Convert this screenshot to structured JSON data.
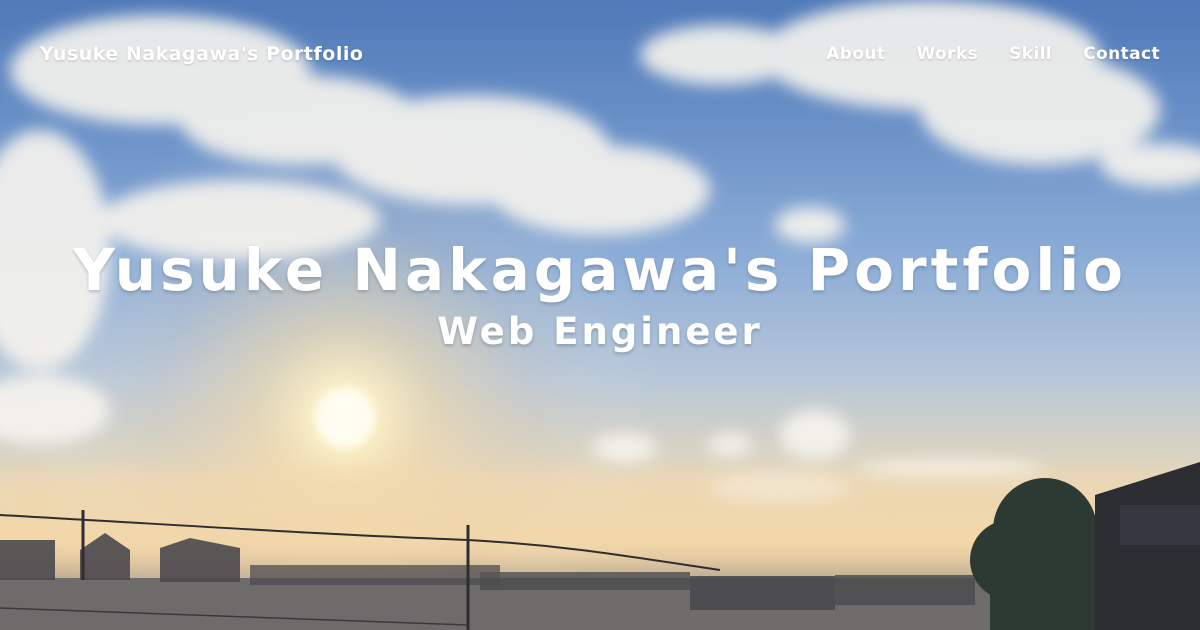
{
  "header": {
    "brand": "Yusuke Nakagawa's Portfolio",
    "nav": [
      {
        "label": "About"
      },
      {
        "label": "Works"
      },
      {
        "label": "Skill"
      },
      {
        "label": "Contact"
      }
    ]
  },
  "hero": {
    "title": "Yusuke Nakagawa's Portfolio",
    "subtitle": "Web Engineer",
    "background_image": "sky-sunset-photo"
  },
  "colors": {
    "text": "#ffffff",
    "sky_top": "#4f79b8",
    "sky_mid": "#8eaed7",
    "horizon": "#f4d7a4"
  }
}
